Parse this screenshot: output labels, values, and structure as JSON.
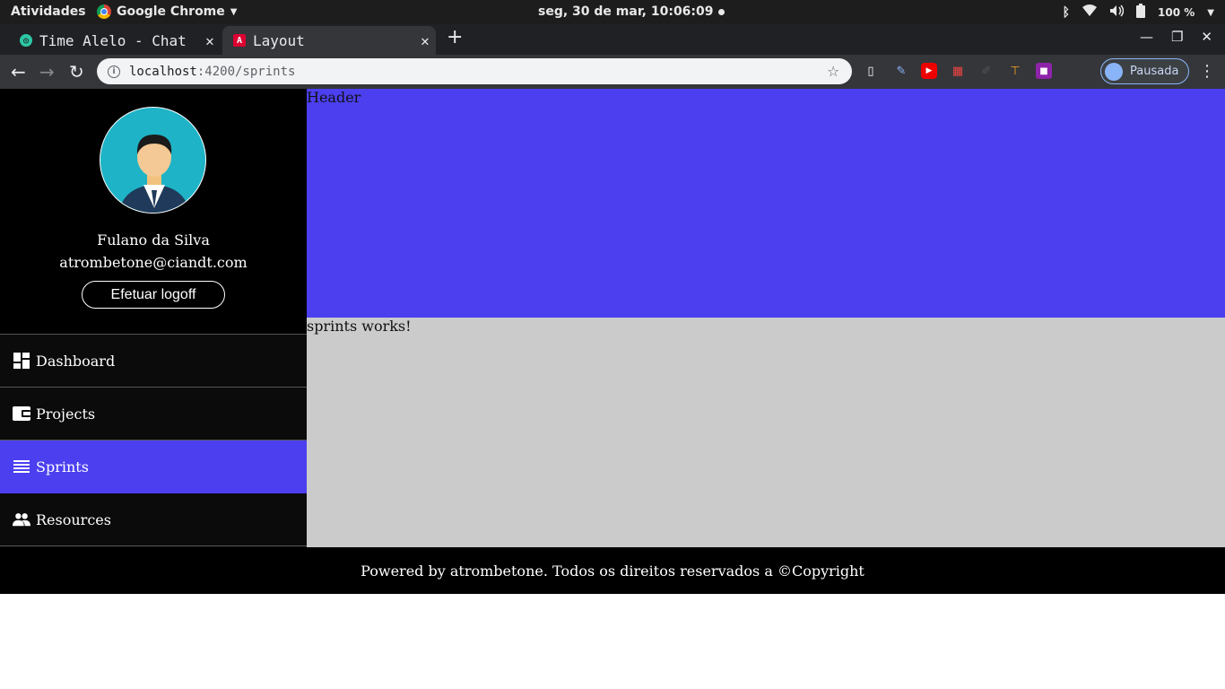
{
  "system": {
    "activities": "Atividades",
    "app_name": "Google Chrome",
    "clock": "seg, 30 de mar, 10:06:09",
    "battery": "100 %"
  },
  "browser": {
    "tabs": [
      {
        "label": "Time Alelo - Chat"
      },
      {
        "label": "Layout"
      }
    ],
    "url_host": "localhost",
    "url_rest": ":4200/sprints",
    "profile_label": "Pausada"
  },
  "sidebar": {
    "user_name": "Fulano da Silva",
    "user_email": "atrombetone@ciandt.com",
    "logoff_label": "Efetuar logoff",
    "items": [
      {
        "label": "Dashboard",
        "icon": "dashboard-icon"
      },
      {
        "label": "Projects",
        "icon": "wallet-icon"
      },
      {
        "label": "Sprints",
        "icon": "list-icon",
        "active": true
      },
      {
        "label": "Resources",
        "icon": "people-icon"
      }
    ]
  },
  "main": {
    "header_text": "Header",
    "content_text": "sprints works!"
  },
  "footer": {
    "text": "Powered by atrombetone. Todos os direitos reservados a ©Copyright"
  },
  "colors": {
    "accent": "#4b3ff0",
    "sidebar_bg": "#0b0b0b",
    "content_bg": "#cbcbcb"
  }
}
